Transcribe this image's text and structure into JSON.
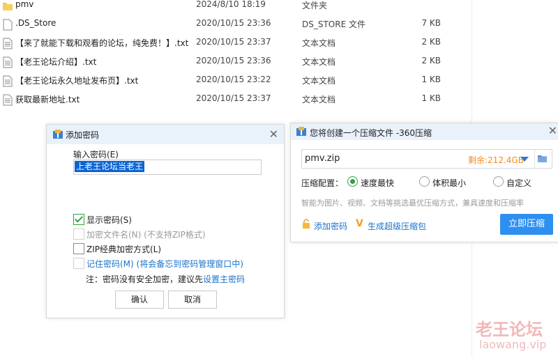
{
  "files": [
    {
      "name": "pmv",
      "date": "2024/8/10 18:19",
      "type": "文件夹",
      "size": "",
      "icon": "folder-icon"
    },
    {
      "name": ".DS_Store",
      "date": "2020/10/15 23:36",
      "type": "DS_STORE 文件",
      "size": "7 KB",
      "icon": "file-icon"
    },
    {
      "name": "【来了就能下载和观看的论坛，纯免费！】.txt",
      "date": "2020/10/15 23:37",
      "type": "文本文档",
      "size": "2 KB",
      "icon": "text-file-icon"
    },
    {
      "name": "【老王论坛介绍】.txt",
      "date": "2020/10/15 23:36",
      "type": "文本文档",
      "size": "2 KB",
      "icon": "text-file-icon"
    },
    {
      "name": "【老王论坛永久地址发布页】.txt",
      "date": "2020/10/15 23:22",
      "type": "文本文档",
      "size": "1 KB",
      "icon": "text-file-icon"
    },
    {
      "name": "获取最新地址.txt",
      "date": "2020/10/15 23:37",
      "type": "文本文档",
      "size": "1 KB",
      "icon": "text-file-icon"
    }
  ],
  "password_dialog": {
    "title": "添加密码",
    "close": "✕",
    "input_label": "输入密码(E)",
    "password_value": "上老王论坛当老王",
    "options": [
      {
        "label": "显示密码(S)",
        "checked": true,
        "disabled": false
      },
      {
        "label": "加密文件名(N) (不支持ZIP格式)",
        "checked": false,
        "disabled": true
      },
      {
        "label": "ZIP经典加密方式(L)",
        "checked": false,
        "disabled": false
      },
      {
        "label": "记住密码(M) (将会备忘到密码管理窗口中)",
        "checked": false,
        "disabled": false
      }
    ],
    "note_prefix": "注：密码没有安全加密，建议先",
    "note_link": "设置主密码",
    "ok": "确认",
    "cancel": "取消"
  },
  "zip_dialog": {
    "title": "您将创建一个压缩文件 -360压缩",
    "close": "✕",
    "filename": "pmv.zip",
    "free_space": "剩余:212.4GB",
    "config_label": "压缩配置：",
    "modes": [
      {
        "label": "速度最快",
        "selected": true
      },
      {
        "label": "体积最小",
        "selected": false
      },
      {
        "label": "自定义",
        "selected": false
      }
    ],
    "hint": "智能为图片、视频、文档等挑选最优压缩方式，兼具速度和压缩率",
    "add_password": "添加密码",
    "super_zip": "生成超级压缩包",
    "start_button": "立即压缩",
    "accent": "#2d8ff0"
  },
  "watermark": {
    "title": "老王论坛",
    "url": "laowang.vip"
  }
}
